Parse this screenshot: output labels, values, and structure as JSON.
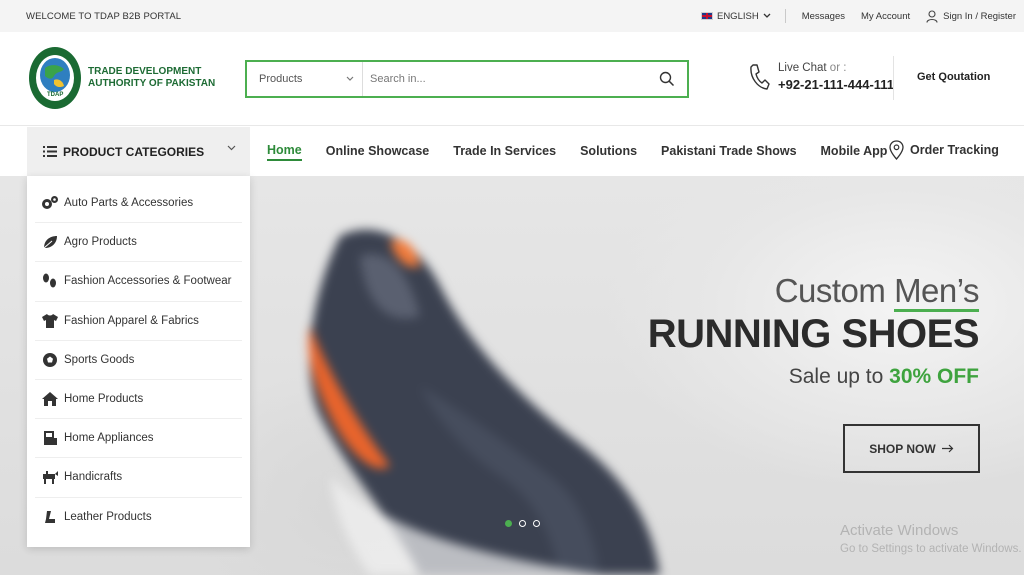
{
  "topbar": {
    "welcome": "WELCOME TO TDAP B2B PORTAL",
    "language": "ENGLISH",
    "messages": "Messages",
    "my_account": "My Account",
    "signin": "Sign In / Register"
  },
  "header": {
    "logo_line1": "TRADE DEVELOPMENT",
    "logo_line2": "AUTHORITY OF PAKISTAN",
    "logo_seal_text": "TDAP",
    "search": {
      "category": "Products",
      "placeholder": "Search in..."
    },
    "contact": {
      "live_chat": "Live Chat",
      "or": "or :",
      "phone": "+92-21-111-444-111"
    },
    "quotation": "Get Qoutation"
  },
  "nav": {
    "categories_label": "PRODUCT CATEGORIES",
    "links": [
      "Home",
      "Online Showcase",
      "Trade In Services",
      "Solutions",
      "Pakistani Trade Shows",
      "Mobile App"
    ],
    "active_index": 0,
    "tracking": "Order Tracking"
  },
  "categories": [
    {
      "label": "Auto Parts & Accessories",
      "icon": "gears-icon"
    },
    {
      "label": "Agro Products",
      "icon": "leaf-icon"
    },
    {
      "label": "Fashion Accessories & Footwear",
      "icon": "footprints-icon"
    },
    {
      "label": "Fashion Apparel & Fabrics",
      "icon": "tshirt-icon"
    },
    {
      "label": "Sports Goods",
      "icon": "soccer-ball-icon"
    },
    {
      "label": "Home Products",
      "icon": "house-icon"
    },
    {
      "label": "Home Appliances",
      "icon": "appliance-icon"
    },
    {
      "label": "Handicrafts",
      "icon": "handicraft-icon"
    },
    {
      "label": "Leather Products",
      "icon": "leather-icon"
    }
  ],
  "hero": {
    "line1_prefix": "Custom ",
    "line1_underlined": "Men’s",
    "line2": "RUNNING SHOES",
    "line3_prefix": "Sale up to ",
    "line3_highlight": "30% OFF",
    "button": "SHOP NOW",
    "slides": 3,
    "active_slide": 0
  },
  "watermark": {
    "line1": "Activate Windows",
    "line2": "Go to Settings to activate Windows."
  },
  "colors": {
    "accent_green": "#2e8b3a",
    "search_border": "#4caf50",
    "highlight": "#3ea33e"
  }
}
